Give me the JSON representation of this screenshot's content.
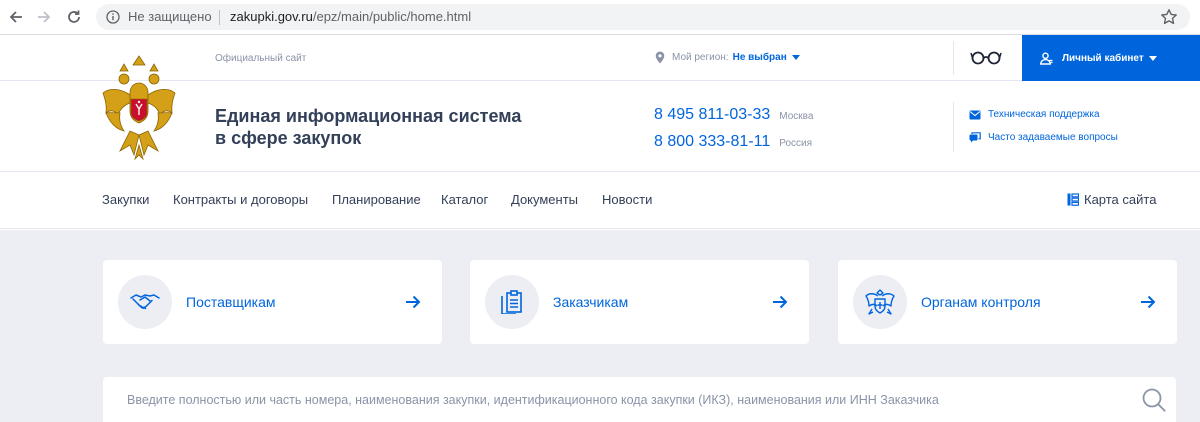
{
  "browser": {
    "security_label": "Не защищено",
    "url_host": "zakupki.gov.ru",
    "url_path": "/epz/main/public/home.html"
  },
  "topbar": {
    "official_site": "Официальный сайт",
    "region_label": "Мой регион:",
    "region_value": "Не выбран",
    "cabinet_label": "Личный кабинет"
  },
  "header": {
    "site_name_line1": "Единая информационная система",
    "site_name_line2": "в сфере закупок",
    "phones": [
      {
        "number": "8 495 811-03-33",
        "city": "Москва"
      },
      {
        "number": "8 800 333-81-11",
        "city": "Россия"
      }
    ],
    "support_links": [
      {
        "label": "Техническая поддержка",
        "icon": "mail-icon"
      },
      {
        "label": "Часто задаваемые вопросы",
        "icon": "chat-icon"
      }
    ]
  },
  "menu": {
    "items": [
      "Закупки",
      "Контракты и договоры",
      "Планирование",
      "Каталог",
      "Документы",
      "Новости"
    ],
    "sitemap_label": "Карта сайта"
  },
  "cards": [
    {
      "label": "Поставщикам",
      "icon": "handshake-icon"
    },
    {
      "label": "Заказчикам",
      "icon": "document-icon"
    },
    {
      "label": "Органам контроля",
      "icon": "emblem-icon"
    }
  ],
  "search": {
    "placeholder": "Введите полностью или часть номера, наименования закупки, идентификационного кода закупки (ИКЗ), наименования или ИНН Заказчика"
  },
  "colors": {
    "accent": "#0065dd",
    "text": "#334059",
    "muted": "#8a93a7",
    "background": "#eceef3"
  }
}
